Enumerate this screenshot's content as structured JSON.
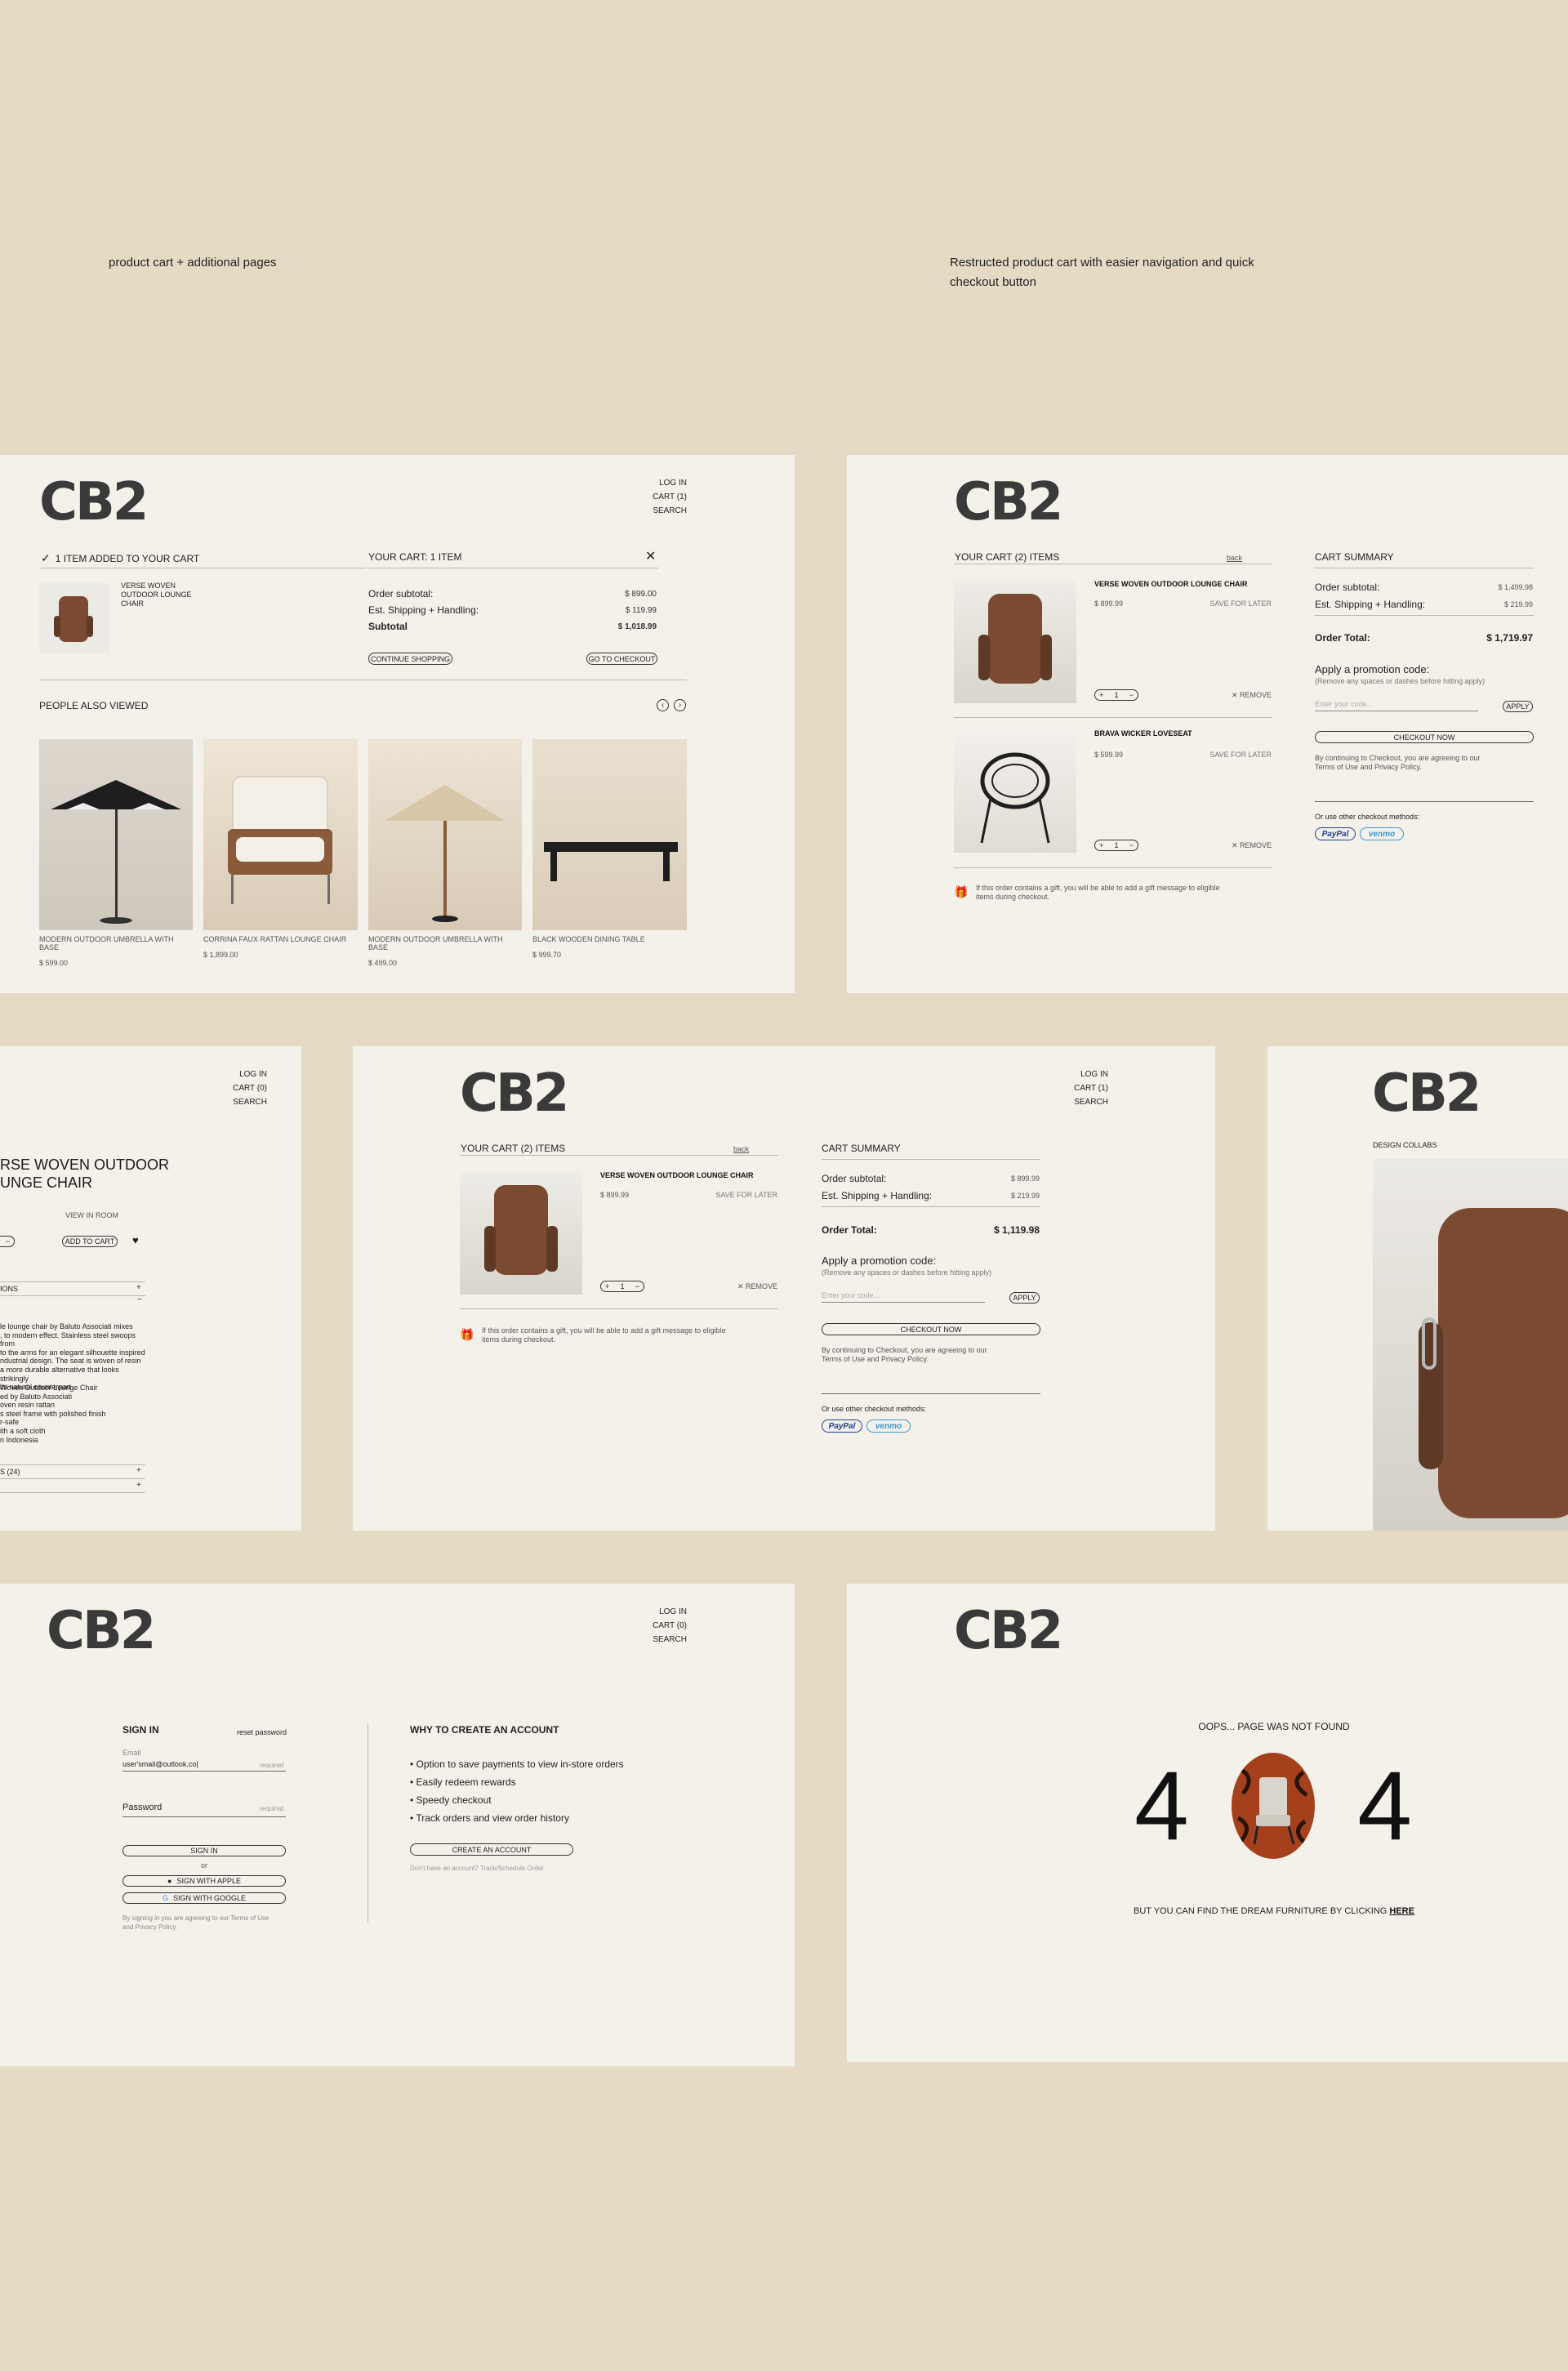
{
  "captions": {
    "left": "product cart + additional pages",
    "right": "Restructed product cart with easier navigation and quick checkout button"
  },
  "brand": "CB2",
  "nav": {
    "login": "LOG IN",
    "cart": "CART (1)",
    "cart0": "CART (0)",
    "search": "SEARCH"
  },
  "p1": {
    "added": "1 ITEM ADDED TO YOUR CART",
    "product": "VERSE WOVEN OUTDOOR LOUNGE CHAIR",
    "your_cart": "YOUR CART: 1 ITEM",
    "order_subtotal": "Order subtotal:",
    "order_subtotal_val": "$ 899.00",
    "shipping": "Est. Shipping + Handling:",
    "shipping_val": "$ 119.99",
    "subtotal": "Subtotal",
    "subtotal_val": "$ 1,018.99",
    "continue": "CONTINUE SHOPPING",
    "checkout": "GO TO CHECKOUT",
    "also": "PEOPLE ALSO VIEWED",
    "items": [
      {
        "name": "MODERN OUTDOOR UMBRELLA WITH BASE",
        "price": "$ 599.00"
      },
      {
        "name": "CORRINA FAUX RATTAN LOUNGE CHAIR",
        "price": "$ 1,899.00"
      },
      {
        "name": "MODERN OUTDOOR UMBRELLA WITH BASE",
        "price": "$ 499.00"
      },
      {
        "name": "BLACK WOODEN DINING TABLE",
        "price": "$ 999.70"
      }
    ]
  },
  "cart": {
    "title2": "YOUR CART (2) ITEMS",
    "back": "back",
    "item1": "VERSE WOVEN OUTDOOR LOUNGE CHAIR",
    "item1_price": "$ 899.99",
    "item2": "BRAVA WICKER LOVESEAT",
    "item2_price": "$ 599.99",
    "save": "SAVE FOR LATER",
    "remove": "REMOVE",
    "qty": "1",
    "gift": "If this order contains a gift, you will be able to add a gift message to eligible items during checkout.",
    "summary": "CART SUMMARY",
    "order_subtotal": "Order subtotal:",
    "subtotal_a": "$ 1,499.98",
    "shipping": "Est. Shipping + Handling:",
    "shipping_val": "$ 219.99",
    "total_label": "Order Total:",
    "total_a": "$ 1,719.97",
    "promo": "Apply a promotion code:",
    "promo_note": "(Remove any spaces or dashes before hitting apply)",
    "promo_ph": "Enter your code...",
    "apply": "APPLY",
    "checkout_now": "CHECKOUT NOW",
    "terms": "By continuing to Checkout, you are agreeing to our Terms of Use and Privacy Policy.",
    "other": "Or use other checkout methods:",
    "paypal": "PayPal",
    "venmo": "venmo",
    "subtotal_b": "$ 899.99",
    "total_b": "$ 1,119.98"
  },
  "pdp": {
    "title_l1": "RSE WOVEN OUTDOOR",
    "title_l2": "UNGE CHAIR",
    "view_room": "VIEW IN ROOM",
    "add": "ADD TO CART",
    "ons": "IONS",
    "desc": [
      "le lounge chair by Baluto Associati mixes",
      ", to modern effect. Stainless steel swoops from",
      "to the arms for an elegant silhouette inspired",
      "ndustrial design. The seat is woven of resin",
      "a more durable alternative that looks strikingly",
      "its natural counterpart."
    ],
    "specs": [
      "Woven Outdoor Lounge Chair",
      "ed by Baluto Associati",
      "oven resin rattan",
      "s steel frame with polished finish",
      "r-safe",
      "ith a soft cloth",
      "n Indonesia"
    ],
    "reviews": "S (24)"
  },
  "collab": {
    "label": "DESIGN COLLABS"
  },
  "signin": {
    "title": "SIGN IN",
    "reset": "reset password",
    "email_label": "Email",
    "email_val": "user'smail@outlook.co|",
    "required": "required",
    "password": "Password",
    "signin_btn": "SIGN IN",
    "or": "or",
    "apple": "SIGN WITH APPLE",
    "google": "SIGN WITH GOOGLE",
    "terms": "By signing in you are agreeing to our Terms of Use and Privacy Policy.",
    "why": "WHY TO CREATE AN ACCOUNT",
    "bullets": [
      "Option to save payments to view in-store orders",
      "Easily redeem rewards",
      "Speedy checkout",
      "Track orders and view order history"
    ],
    "create": "CREATE AN ACCOUNT",
    "no_account": "Don't have an account? Track/Schedule Order"
  },
  "notfound": {
    "oops": "OOPS... PAGE WAS NOT FOUND",
    "d1": "4",
    "d2": "4",
    "bottom": "BUT YOU CAN FIND THE DREAM FURNITURE BY CLICKING",
    "here": "HERE"
  }
}
